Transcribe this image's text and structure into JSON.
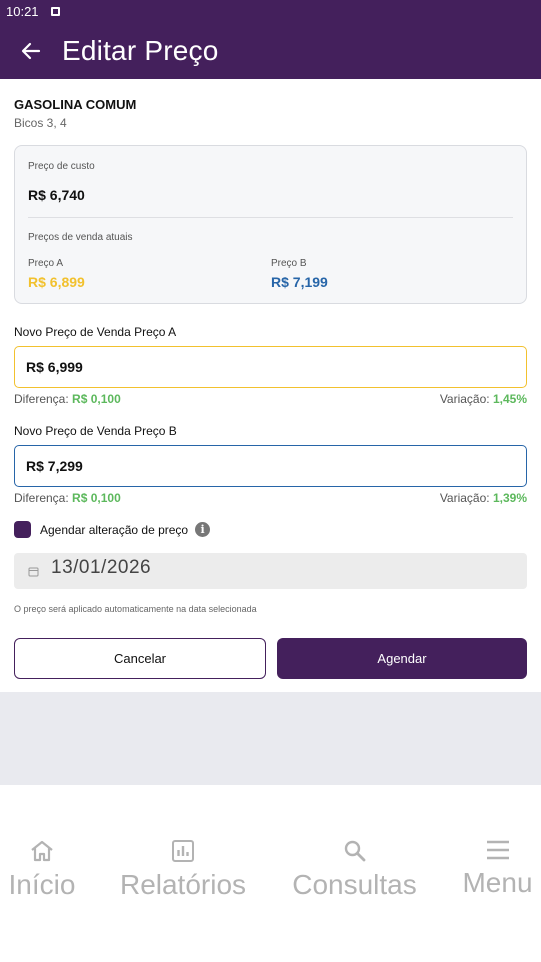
{
  "status_bar": {
    "time": "10:21"
  },
  "app_bar": {
    "title": "Editar Preço"
  },
  "product": {
    "name": "GASOLINA COMUM",
    "pumps": "Bicos 3, 4"
  },
  "price_card": {
    "cost_label": "Preço de custo",
    "cost_value": "R$ 6,740",
    "current_label": "Preços de venda atuais",
    "price_a_label": "Preço A",
    "price_a_value": "R$ 6,899",
    "price_b_label": "Preço B",
    "price_b_value": "R$ 7,199"
  },
  "new_price_a": {
    "label": "Novo Preço de Venda Preço A",
    "value": "R$ 6,999",
    "diff_label": "Diferença:",
    "diff_value": "R$ 0,100",
    "var_label": "Variação:",
    "var_value": "1,45%"
  },
  "new_price_b": {
    "label": "Novo Preço de Venda Preço B",
    "value": "R$ 7,299",
    "diff_label": "Diferença:",
    "diff_value": "R$ 0,100",
    "var_label": "Variação:",
    "var_value": "1,39%"
  },
  "schedule": {
    "checkbox_label": "Agendar alteração de preço",
    "checked": true,
    "date": "13/01/2026",
    "hint": "O preço será aplicado automaticamente na data selecionada"
  },
  "actions": {
    "cancel": "Cancelar",
    "confirm": "Agendar"
  },
  "bottom_nav": {
    "items": [
      {
        "label": "Início",
        "icon": "home-icon"
      },
      {
        "label": "Relatórios",
        "icon": "bar-chart-icon"
      },
      {
        "label": "Consultas",
        "icon": "search-icon"
      },
      {
        "label": "Menu",
        "icon": "menu-icon"
      }
    ]
  },
  "colors": {
    "brand": "#44205c",
    "price_a": "#f2c12e",
    "price_b": "#2765a8",
    "positive": "#5cb85c"
  }
}
